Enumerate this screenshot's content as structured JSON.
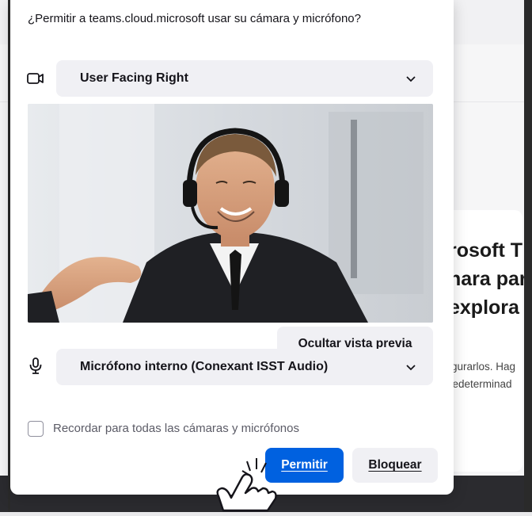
{
  "background": {
    "heading_lines": [
      "rosoft T",
      "nara par",
      "explora"
    ],
    "body_lines": [
      "igurarlos. Hag",
      "redeterminad"
    ]
  },
  "popup": {
    "title": "¿Permitir a teams.cloud.microsoft usar su cámara y micrófono?",
    "camera": {
      "icon": "camera-icon",
      "selected": "User Facing Right"
    },
    "preview_toggle_label": "Ocultar vista previa",
    "microphone": {
      "icon": "microphone-icon",
      "selected": "Micrófono interno (Conexant ISST Audio)"
    },
    "remember_label": "Recordar para todas las cámaras y micrófonos",
    "remember_checked": false,
    "allow_label": "Permitir",
    "block_label": "Bloquear",
    "accent_color": "#0061e0"
  }
}
